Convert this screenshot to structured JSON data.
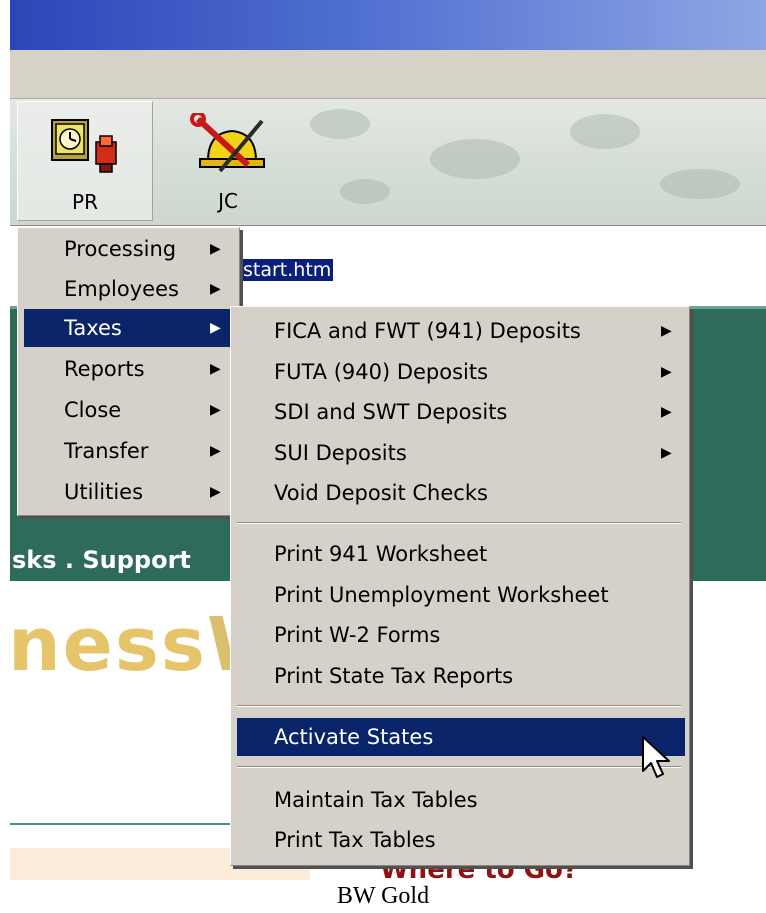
{
  "toolbar": {
    "buttons": [
      {
        "label": "PR",
        "icon": "payroll-clock-icon"
      },
      {
        "label": "JC",
        "icon": "job-cost-hardhat-icon"
      }
    ]
  },
  "address": {
    "url_fragment": "start.htm"
  },
  "background": {
    "banner_text": "sks . Support",
    "logo_text_main": "ness",
    "logo_text_w": "W",
    "link_text": "Where to Go?"
  },
  "main_menu": {
    "items": [
      "Processing",
      "Employees",
      "Taxes",
      "Reports",
      "Close",
      "Transfer",
      "Utilities"
    ],
    "selected": "Taxes"
  },
  "taxes_menu": {
    "groups": [
      [
        "FICA and FWT (941) Deposits",
        "FUTA (940) Deposits",
        "SDI and SWT Deposits",
        "SUI Deposits",
        "Void Deposit Checks"
      ],
      [
        "Print 941 Worksheet",
        "Print Unemployment Worksheet",
        "Print W-2 Forms",
        "Print State Tax Reports"
      ],
      [
        "Activate States"
      ],
      [
        "Maintain Tax Tables",
        "Print Tax Tables"
      ]
    ],
    "selected": "Activate States"
  },
  "caption": "BW Gold",
  "colors": {
    "highlight": "#0a246a",
    "menu_bg": "#d5d0c8",
    "title_blue": "#2c46b8",
    "green_band": "#2e6b5a"
  }
}
